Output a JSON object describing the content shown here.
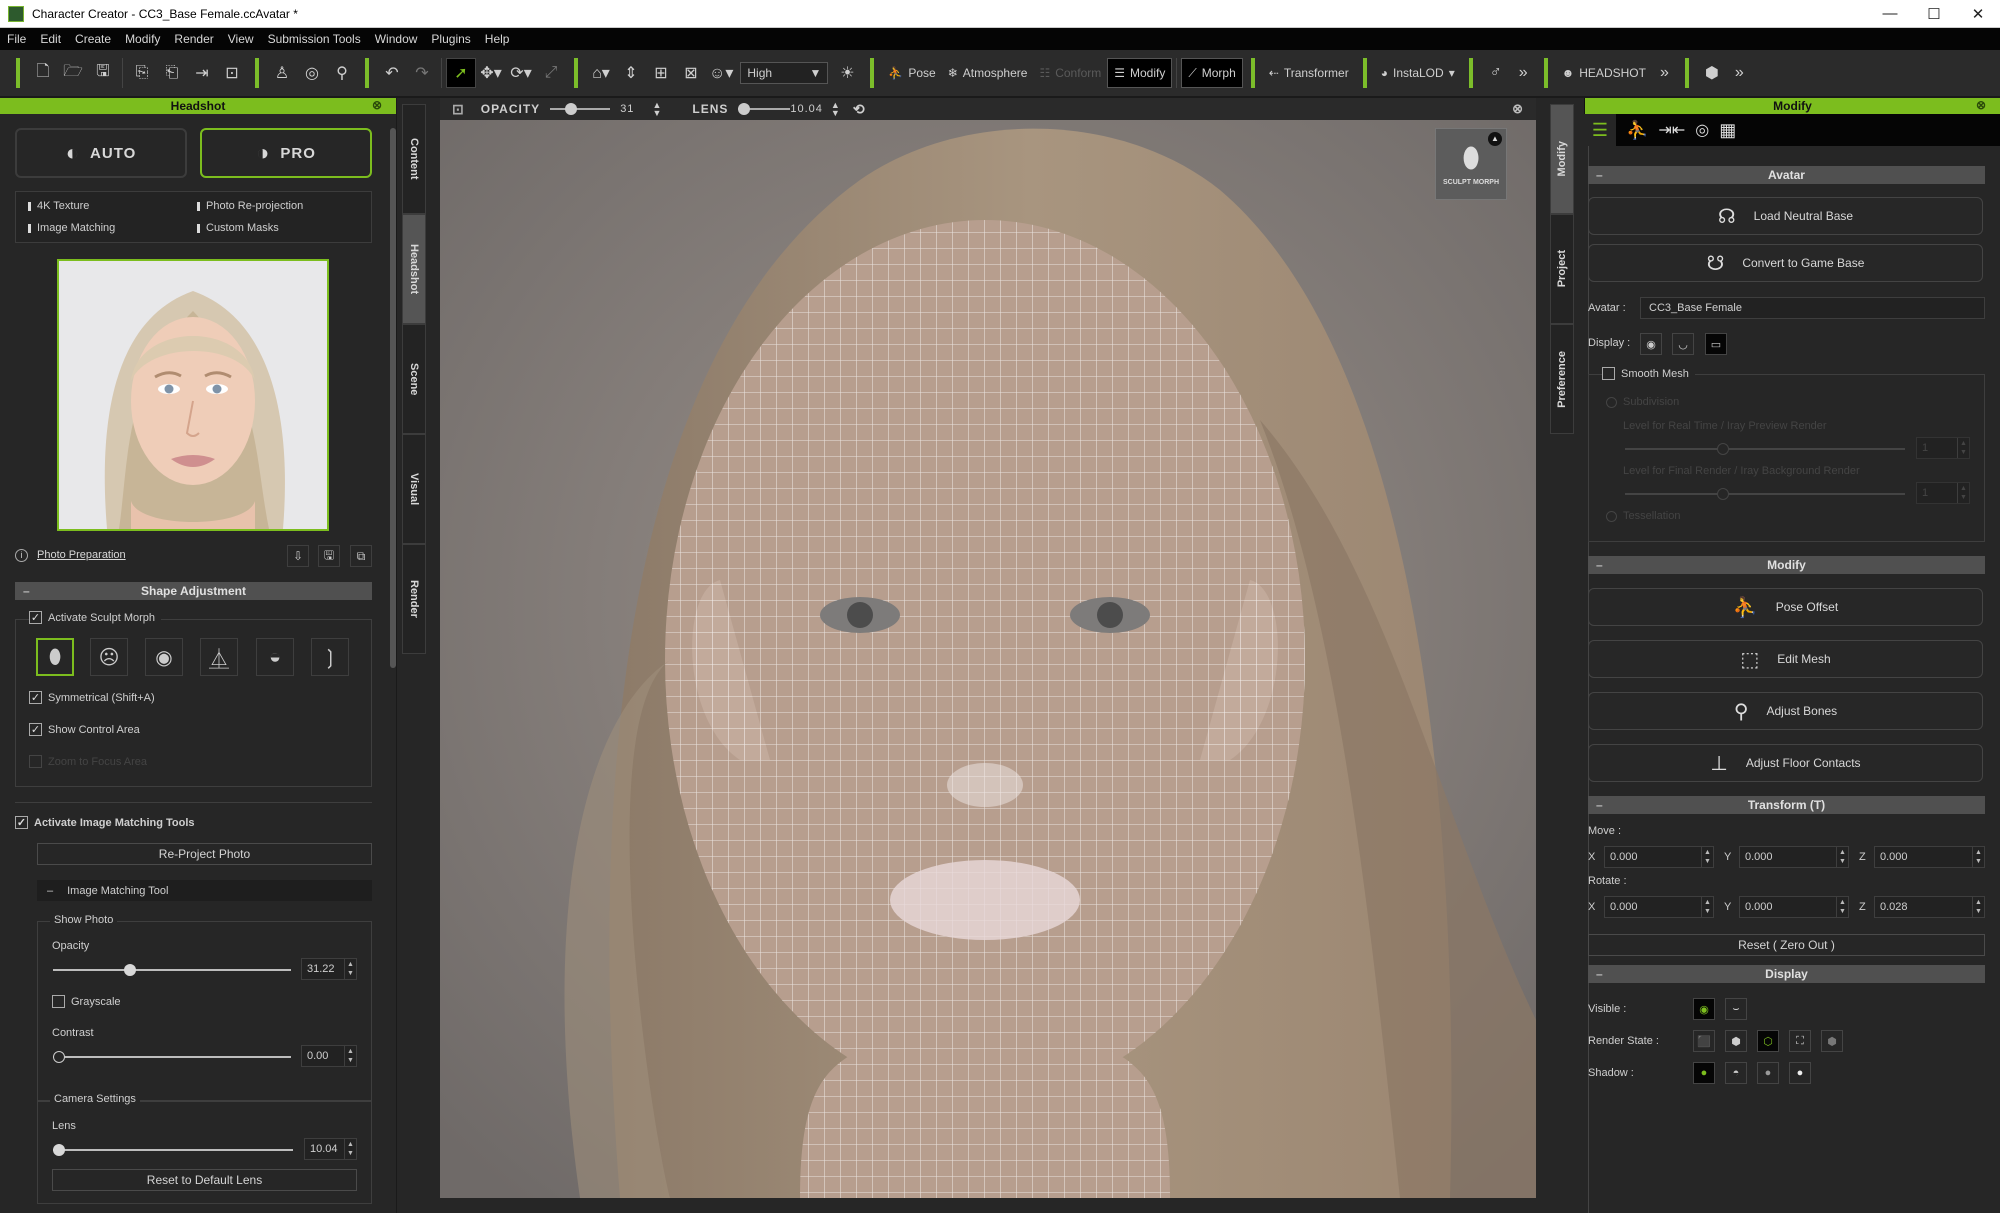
{
  "window": {
    "title": "Character Creator - CC3_Base Female.ccAvatar *",
    "minimize": "—",
    "maximize": "☐",
    "close": "✕"
  },
  "menu": [
    "File",
    "Edit",
    "Create",
    "Modify",
    "Render",
    "View",
    "Submission Tools",
    "Window",
    "Plugins",
    "Help"
  ],
  "toolbar": {
    "quality_select": "High",
    "pose_label": "Pose",
    "atmosphere_label": "Atmosphere",
    "conform_label": "Conform",
    "modify_label": "Modify",
    "morph_label": "Morph",
    "transformer_label": "Transformer",
    "instalod_label": "InstaLOD",
    "headshot_label": "HEADSHOT",
    "more": "»",
    "accent_color": "#7cbd1e"
  },
  "left_panel": {
    "title": "Headshot",
    "close": "⊗",
    "mode_auto": "AUTO",
    "mode_pro": "PRO",
    "selected_mode": "PRO",
    "features": [
      "4K Texture",
      "Photo Re-projection",
      "Image Matching",
      "Custom Masks"
    ],
    "photo_prep_link": "Photo Preparation",
    "shape_adjustment": {
      "header": "Shape Adjustment",
      "activate_sculpt_morph": {
        "label": "Activate Sculpt Morph",
        "checked": true
      },
      "morph_regions": [
        "full-head",
        "face",
        "eye",
        "nose",
        "mouth",
        "ear"
      ],
      "selected_region": "full-head",
      "symmetrical": {
        "label": "Symmetrical (Shift+A)",
        "checked": true
      },
      "show_control_area": {
        "label": "Show Control Area",
        "checked": true
      },
      "zoom_to_focus": {
        "label": "Zoom to Focus Area",
        "checked": false,
        "enabled": false
      }
    },
    "image_matching": {
      "activate": {
        "label": "Activate Image Matching Tools",
        "checked": true
      },
      "reproject_button": "Re-Project Photo",
      "tool_header": "Image Matching Tool",
      "show_photo_group": "Show Photo",
      "opacity_label": "Opacity",
      "opacity_value": "31.22",
      "opacity_fraction": 0.3122,
      "grayscale": {
        "label": "Grayscale",
        "checked": false
      },
      "contrast_label": "Contrast",
      "contrast_value": "0.00",
      "contrast_fraction": 0.0,
      "camera_group": "Camera Settings",
      "lens_label": "Lens",
      "lens_value": "10.04",
      "lens_fraction": 0.0,
      "reset_lens_button": "Reset to Default Lens"
    },
    "side_tabs": [
      "Content",
      "Headshot",
      "Scene",
      "Visual",
      "Render"
    ],
    "active_side_tab": "Headshot"
  },
  "viewport": {
    "opacity_label": "OPACITY",
    "opacity_value": "31",
    "opacity_fraction": 0.31,
    "lens_label": "LENS",
    "lens_value": "10.04",
    "sculpt_morph_badge": "SCULPT MORPH"
  },
  "right_panel": {
    "title": "Modify",
    "close": "⊗",
    "side_tabs": [
      "Modify",
      "Project",
      "Preference"
    ],
    "active_side_tab": "Modify",
    "avatar_section": {
      "header": "Avatar",
      "load_neutral_base": "Load Neutral Base",
      "convert_game_base": "Convert to Game Base",
      "avatar_label": "Avatar :",
      "avatar_name": "CC3_Base Female",
      "display_label": "Display :",
      "smooth_mesh": {
        "label": "Smooth Mesh",
        "checked": false
      },
      "subdivision_label": "Subdivision",
      "realtime_level_label": "Level for Real Time / Iray Preview Render",
      "realtime_level_value": "1",
      "final_level_label": "Level for Final Render / Iray Background Render",
      "final_level_value": "1",
      "tessellation_label": "Tessellation"
    },
    "modify_section": {
      "header": "Modify",
      "buttons": [
        "Pose Offset",
        "Edit Mesh",
        "Adjust Bones",
        "Adjust Floor Contacts"
      ]
    },
    "transform_section": {
      "header": "Transform  (T)",
      "move_label": "Move :",
      "rotate_label": "Rotate :",
      "move": {
        "x": "0.000",
        "y": "0.000",
        "z": "0.000"
      },
      "rotate": {
        "x": "0.000",
        "y": "0.000",
        "z": "0.028"
      },
      "reset_button": "Reset ( Zero Out )"
    },
    "display_section": {
      "header": "Display",
      "visible_label": "Visible :",
      "render_state_label": "Render State :",
      "shadow_label": "Shadow :"
    }
  }
}
